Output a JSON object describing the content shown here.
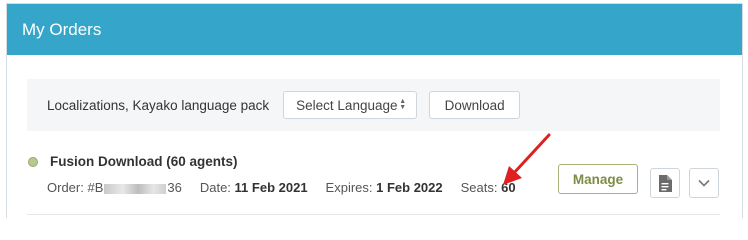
{
  "panel": {
    "title": "My Orders"
  },
  "language_pack": {
    "label": "Localizations, Kayako language pack",
    "select_value": "Select Language",
    "download_label": "Download"
  },
  "order": {
    "status_color": "#b8c98f",
    "product": "Fusion Download (60 agents)",
    "order_label": "Order:",
    "order_prefix": "#B",
    "order_suffix": "36",
    "date_label": "Date:",
    "date_value": "11 Feb 2021",
    "expires_label": "Expires:",
    "expires_value": "1 Feb 2022",
    "seats_label": "Seats:",
    "seats_value": "60",
    "manage_label": "Manage"
  },
  "colors": {
    "header_bg": "#35a5c9",
    "manage_accent": "#7d8c45",
    "annotation_arrow": "#e02020"
  }
}
